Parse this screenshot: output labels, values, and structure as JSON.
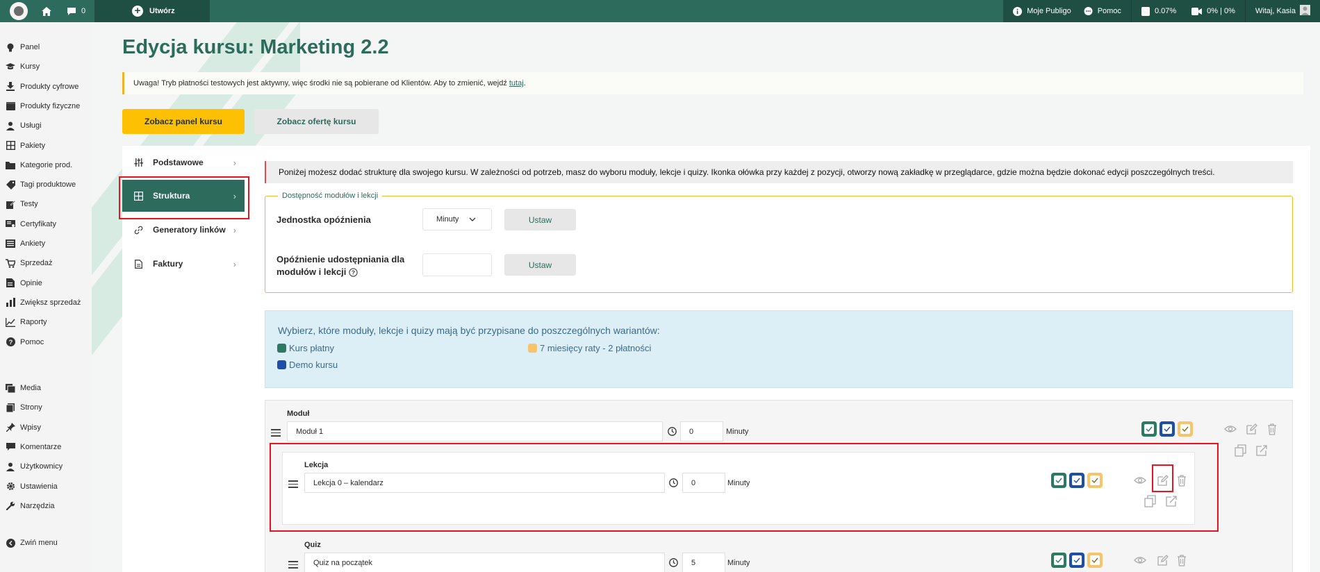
{
  "topbar": {
    "comments_count": "0",
    "create_label": "Utwórz",
    "my_account": "Moje Publigo",
    "help": "Pomoc",
    "percent_a": "0.07%",
    "percent_b": "0% | 0%",
    "greeting": "Witaj, Kasia"
  },
  "sidebar": {
    "items": [
      {
        "label": "Panel",
        "icon": "lightbulb-icon"
      },
      {
        "label": "Kursy",
        "icon": "graduation-cap-icon"
      },
      {
        "label": "Produkty cyfrowe",
        "icon": "download-icon"
      },
      {
        "label": "Produkty fizyczne",
        "icon": "box-icon"
      },
      {
        "label": "Usługi",
        "icon": "person-icon"
      },
      {
        "label": "Pakiety",
        "icon": "grid-icon"
      },
      {
        "label": "Kategorie prod.",
        "icon": "folder-icon"
      },
      {
        "label": "Tagi produktowe",
        "icon": "tag-icon"
      },
      {
        "label": "Testy",
        "icon": "edit-icon"
      },
      {
        "label": "Certyfikaty",
        "icon": "certificate-icon"
      },
      {
        "label": "Ankiety",
        "icon": "survey-icon"
      },
      {
        "label": "Sprzedaż",
        "icon": "cart-icon"
      },
      {
        "label": "Opinie",
        "icon": "opinion-icon"
      },
      {
        "label": "Zwiększ sprzedaż",
        "icon": "bar-chart-icon"
      },
      {
        "label": "Raporty",
        "icon": "line-chart-icon"
      },
      {
        "label": "Pomoc",
        "icon": "help-icon"
      }
    ],
    "items2": [
      {
        "label": "Media",
        "icon": "media-icon"
      },
      {
        "label": "Strony",
        "icon": "pages-icon"
      },
      {
        "label": "Wpisy",
        "icon": "pin-icon"
      },
      {
        "label": "Komentarze",
        "icon": "comment-icon"
      },
      {
        "label": "Użytkownicy",
        "icon": "users-icon"
      },
      {
        "label": "Ustawienia",
        "icon": "settings-icon"
      },
      {
        "label": "Narzędzia",
        "icon": "wrench-icon"
      }
    ],
    "collapse": "Zwiń menu"
  },
  "page": {
    "title": "Edycja kursu: Marketing 2.2",
    "notice_text": "Uwaga! Tryb płatności testowych jest aktywny, więc środki nie są pobierane od Klientów. Aby to zmienić, wejdź",
    "notice_link": "tutaj",
    "notice_end": ".",
    "btn_panel": "Zobacz panel kursu",
    "btn_offer": "Zobacz ofertę kursu"
  },
  "tabs": [
    {
      "label": "Podstawowe"
    },
    {
      "label": "Struktura"
    },
    {
      "label": "Generatory linków"
    },
    {
      "label": "Faktury"
    }
  ],
  "structure": {
    "info": "Poniżej możesz dodać strukturę dla swojego kursu. W zależności od potrzeb, masz do wyboru moduły, lekcje i quizy. Ikonka ołówka przy każdej z pozycji, otworzy nową zakładkę w przeglądarce, gdzie można będzie dokonać edycji poszczególnych treści.",
    "availability_legend": "Dostępność modułów i lekcji",
    "delay_unit_label": "Jednostka opóźnienia",
    "delay_unit_value": "Minuty",
    "set_label": "Ustaw",
    "share_delay_label_1": "Opóźnienie udostępniania dla",
    "share_delay_label_2": "modułów i lekcji",
    "variants_title": "Wybierz, które moduły, lekcje i quizy mają być przypisane do poszczególnych wariantów:",
    "variants": [
      {
        "label": "Kurs płatny",
        "color": "#2d7a62"
      },
      {
        "label": "7 miesięcy raty - 2 płatności",
        "color": "#f6c56b"
      },
      {
        "label": "Demo kursu",
        "color": "#1d4fa8"
      }
    ],
    "module": {
      "label": "Moduł",
      "name": "Moduł 1",
      "delay": "0",
      "unit": "Minuty"
    },
    "lesson": {
      "label": "Lekcja",
      "name": "Lekcja 0 – kalendarz",
      "delay": "0",
      "unit": "Minuty"
    },
    "quiz": {
      "label": "Quiz",
      "name": "Quiz na początek",
      "delay": "5",
      "unit": "Minuty"
    }
  }
}
